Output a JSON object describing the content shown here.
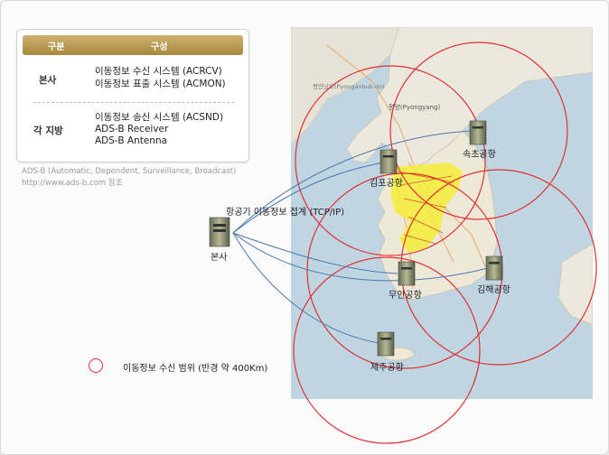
{
  "table": {
    "header_col1": "구분",
    "header_col2": "구성",
    "rows": [
      {
        "category": "본사",
        "items": [
          "이동정보 수신 시스템 (ACRCV)",
          "이동정보 표출 시스템 (ACMON)"
        ]
      },
      {
        "category": "각 지방",
        "items": [
          "이동정보 송신 시스템 (ACSND)",
          "ADS-B Receiver",
          "ADS-B Antenna"
        ]
      }
    ]
  },
  "notes": {
    "line1": "ADS-B (Automatic, Dependent, Surveillance, Broadcast)",
    "line2": "http://www.ads-b.com 참조"
  },
  "diagram": {
    "link_label": "항공기 이동정보 접계 (TCP/IP)",
    "hq_label": "본사",
    "airports": {
      "gimpo": "김포공항",
      "sokcho": "속초공항",
      "muan": "무안공항",
      "gimhae": "김해공항",
      "jeju": "제주공항"
    },
    "map_labels": {
      "pyongyang": "평양(Pyongyang)",
      "pyongyang_region": "평안남도(Pyonganbuk-do)"
    },
    "legend_label": "이동정보 수신 범위 (반경 약 400Km)"
  },
  "colors": {
    "range_circle": "#e03030",
    "link_line": "#4a78b0",
    "header_gold": "#b8963f"
  }
}
